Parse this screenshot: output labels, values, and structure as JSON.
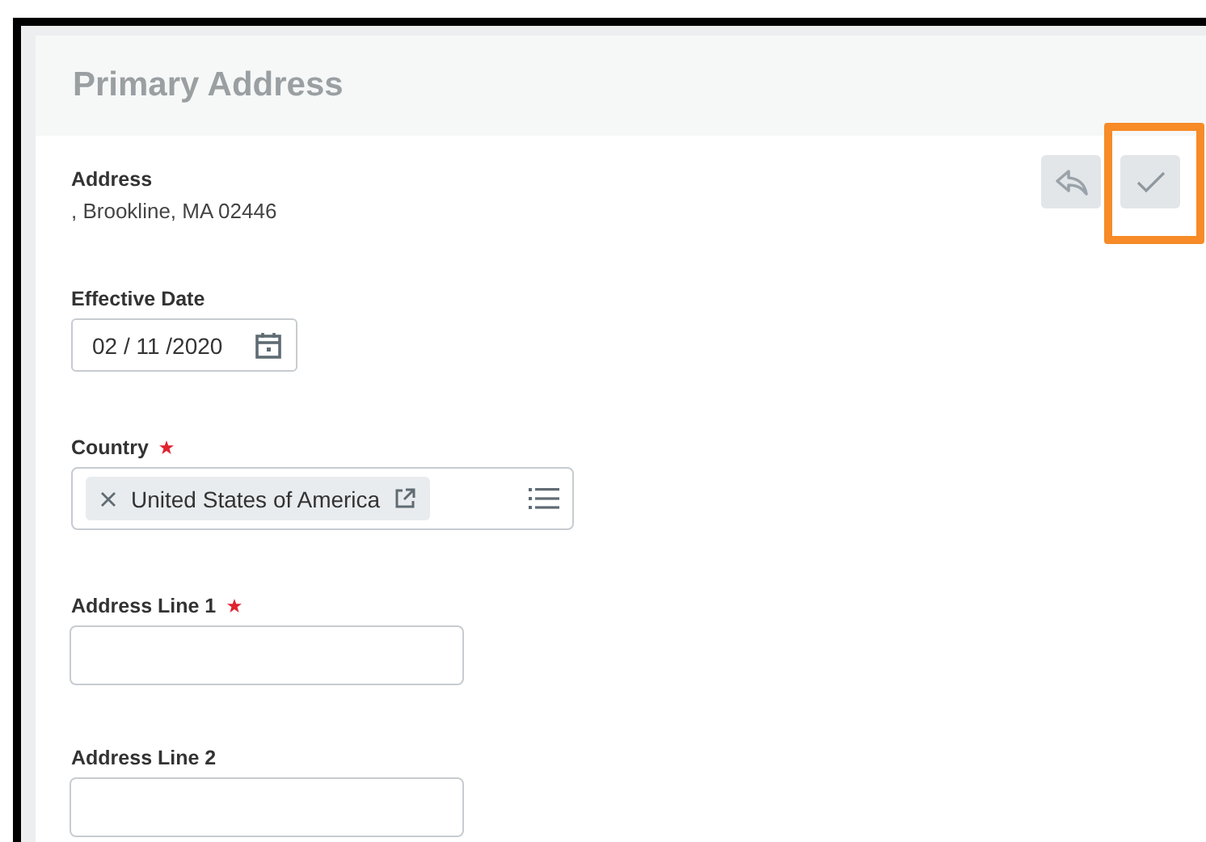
{
  "header": {
    "title": "Primary Address"
  },
  "actions": [
    {
      "kind": "cancel"
    },
    {
      "kind": "submit",
      "highlighted": true
    }
  ],
  "address": {
    "label": "Address",
    "value": ", Brookline, MA 02446"
  },
  "fields": [
    {
      "kind": "date",
      "label": "Effective Date",
      "required": false,
      "value": "02 / 11 /2020"
    },
    {
      "kind": "select",
      "label": "Country",
      "required": true,
      "value": "United States of America"
    },
    {
      "kind": "text",
      "label": "Address Line 1",
      "required": true
    },
    {
      "kind": "text",
      "label": "Address Line 2",
      "required": false
    }
  ]
}
